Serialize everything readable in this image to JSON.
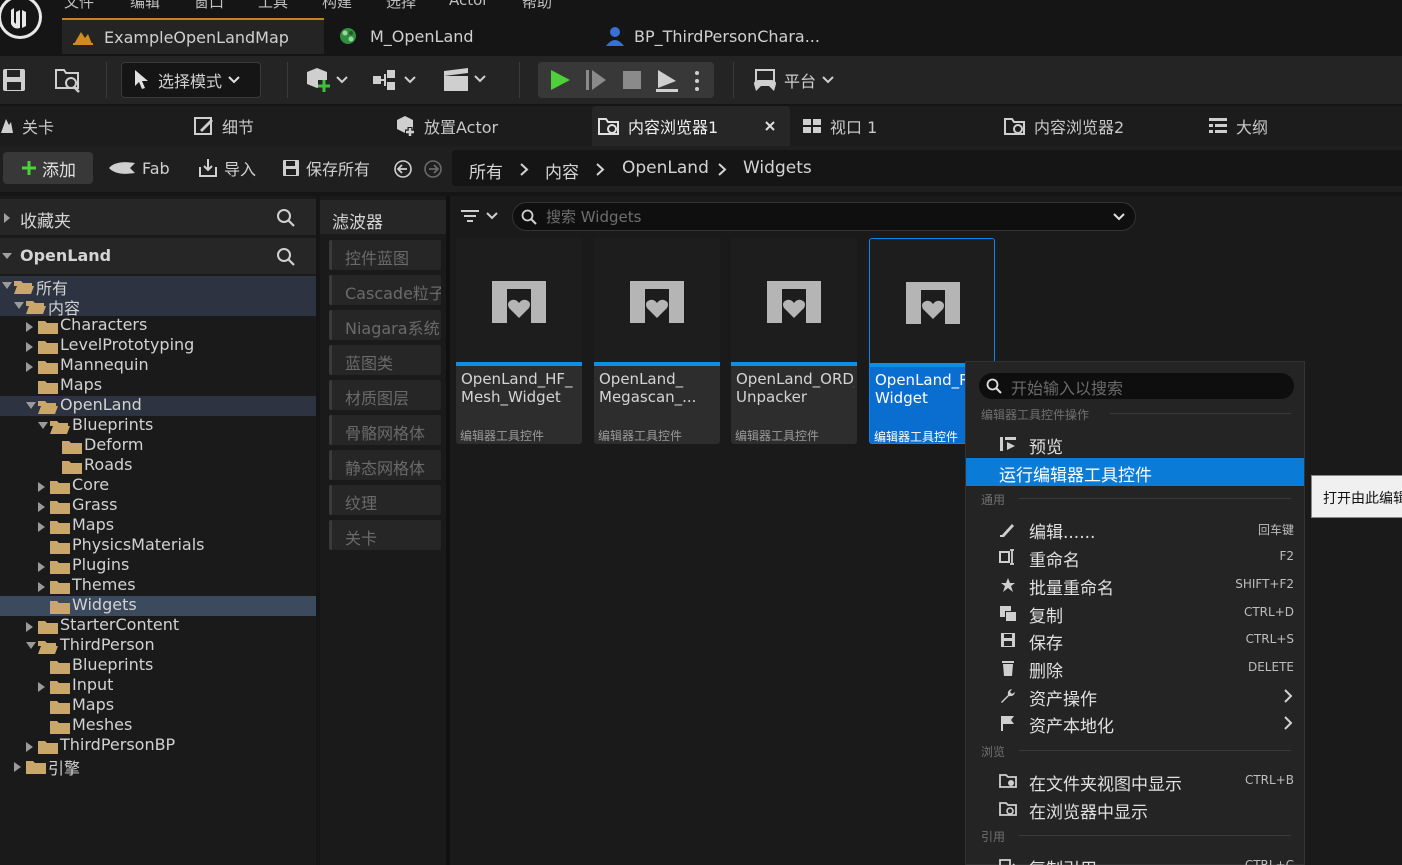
{
  "menubar": {
    "items": [
      "文件",
      "编辑",
      "窗口",
      "工具",
      "构建",
      "选择",
      "Actor",
      "帮助"
    ]
  },
  "doc_tabs": [
    {
      "label": "ExampleOpenLandMap",
      "active": true
    },
    {
      "label": "M_OpenLand",
      "active": false
    },
    {
      "label": "BP_ThirdPersonChara...",
      "active": false
    }
  ],
  "toolbar": {
    "mode_label": "选择模式",
    "platform_label": "平台"
  },
  "panel_tabs": [
    {
      "label": "关卡"
    },
    {
      "label": "细节"
    },
    {
      "label": "放置Actor"
    },
    {
      "label": "内容浏览器1",
      "active": true
    },
    {
      "label": "视口 1"
    },
    {
      "label": "内容浏览器2"
    },
    {
      "label": "大纲"
    }
  ],
  "content_toolbar": {
    "add_label": "添加",
    "fab_label": "Fab",
    "import_label": "导入",
    "save_all_label": "保存所有",
    "breadcrumbs": [
      "所有",
      "内容",
      "OpenLand",
      "Widgets"
    ]
  },
  "sidebar": {
    "favorites_label": "收藏夹",
    "root_label": "OpenLand",
    "tree": [
      {
        "label": "所有",
        "depth": 0,
        "expanded": true,
        "arrow": true,
        "state": "hl"
      },
      {
        "label": "内容",
        "depth": 1,
        "expanded": true,
        "arrow": true,
        "state": "hl"
      },
      {
        "label": "Characters",
        "depth": 2,
        "expanded": false,
        "arrow": true
      },
      {
        "label": "LevelPrototyping",
        "depth": 2,
        "expanded": false,
        "arrow": true
      },
      {
        "label": "Mannequin",
        "depth": 2,
        "expanded": false,
        "arrow": true
      },
      {
        "label": "Maps",
        "depth": 2,
        "expanded": false,
        "arrow": false
      },
      {
        "label": "OpenLand",
        "depth": 2,
        "expanded": true,
        "arrow": true,
        "state": "hl"
      },
      {
        "label": "Blueprints",
        "depth": 3,
        "expanded": true,
        "arrow": true
      },
      {
        "label": "Deform",
        "depth": 4,
        "expanded": false,
        "arrow": false
      },
      {
        "label": "Roads",
        "depth": 4,
        "expanded": false,
        "arrow": false
      },
      {
        "label": "Core",
        "depth": 3,
        "expanded": false,
        "arrow": true
      },
      {
        "label": "Grass",
        "depth": 3,
        "expanded": false,
        "arrow": true
      },
      {
        "label": "Maps",
        "depth": 3,
        "expanded": false,
        "arrow": true
      },
      {
        "label": "PhysicsMaterials",
        "depth": 3,
        "expanded": false,
        "arrow": false
      },
      {
        "label": "Plugins",
        "depth": 3,
        "expanded": false,
        "arrow": true
      },
      {
        "label": "Themes",
        "depth": 3,
        "expanded": false,
        "arrow": true
      },
      {
        "label": "Widgets",
        "depth": 3,
        "expanded": false,
        "arrow": false,
        "state": "sel"
      },
      {
        "label": "StarterContent",
        "depth": 2,
        "expanded": false,
        "arrow": true
      },
      {
        "label": "ThirdPerson",
        "depth": 2,
        "expanded": true,
        "arrow": true
      },
      {
        "label": "Blueprints",
        "depth": 3,
        "expanded": false,
        "arrow": false
      },
      {
        "label": "Input",
        "depth": 3,
        "expanded": false,
        "arrow": true
      },
      {
        "label": "Maps",
        "depth": 3,
        "expanded": false,
        "arrow": false
      },
      {
        "label": "Meshes",
        "depth": 3,
        "expanded": false,
        "arrow": false
      },
      {
        "label": "ThirdPersonBP",
        "depth": 2,
        "expanded": false,
        "arrow": true
      },
      {
        "label": "引擎",
        "depth": 1,
        "expanded": false,
        "arrow": true
      }
    ]
  },
  "filters": {
    "header": "滤波器",
    "items": [
      "控件蓝图",
      "Cascade粒子",
      "Niagara系统",
      "蓝图类",
      "材质图层",
      "骨骼网格体",
      "静态网格体",
      "纹理",
      "关卡"
    ]
  },
  "assets": {
    "search_placeholder": "搜索 Widgets",
    "items": [
      {
        "name": "OpenLand_HF_\nMesh_Widget",
        "type": "编辑器工具控件",
        "selected": false
      },
      {
        "name": "OpenLand_\nMegascan_...",
        "type": "编辑器工具控件",
        "selected": false
      },
      {
        "name": "OpenLand_ORD_\nUnpacker",
        "type": "编辑器工具控件",
        "selected": false
      },
      {
        "name": "OpenLand_RV_\nWidget",
        "type": "编辑器工具控件",
        "selected": true
      }
    ]
  },
  "context_menu": {
    "search_placeholder": "开始输入以搜索",
    "sections": [
      {
        "header": "编辑器工具控件操作",
        "items": [
          {
            "label": "预览",
            "shortcut": "",
            "icon": "preview-icon"
          },
          {
            "label": "运行编辑器工具控件",
            "shortcut": "",
            "icon": "",
            "highlighted": true
          }
        ]
      },
      {
        "header": "通用",
        "items": [
          {
            "label": "编辑......",
            "shortcut": "回车键",
            "icon": "edit-icon"
          },
          {
            "label": "重命名",
            "shortcut": "F2",
            "icon": "rename-icon"
          },
          {
            "label": "批量重命名",
            "shortcut": "SHIFT+F2",
            "icon": "batch-rename-icon"
          },
          {
            "label": "复制",
            "shortcut": "CTRL+D",
            "icon": "duplicate-icon"
          },
          {
            "label": "保存",
            "shortcut": "CTRL+S",
            "icon": "save-icon"
          },
          {
            "label": "删除",
            "shortcut": "DELETE",
            "icon": "delete-icon"
          },
          {
            "label": "资产操作",
            "shortcut": "",
            "icon": "wrench-icon",
            "submenu": true
          },
          {
            "label": "资产本地化",
            "shortcut": "",
            "icon": "flag-icon",
            "submenu": true
          }
        ]
      },
      {
        "header": "浏览",
        "items": [
          {
            "label": "在文件夹视图中显示",
            "shortcut": "CTRL+B",
            "icon": "folder-view-icon"
          },
          {
            "label": "在浏览器中显示",
            "shortcut": "",
            "icon": "browser-icon"
          }
        ]
      },
      {
        "header": "引用",
        "items": [
          {
            "label": "复制引用",
            "shortcut": "CTRL+C",
            "icon": "copy-reference-icon"
          }
        ]
      }
    ]
  },
  "tooltip": {
    "text": "打开由此编辑器工具控件"
  }
}
